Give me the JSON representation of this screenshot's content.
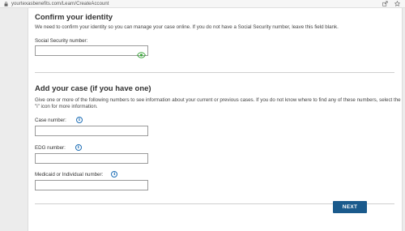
{
  "browser": {
    "url": "yourtexasbenefits.com/Learn/CreateAccount"
  },
  "identity": {
    "heading": "Confirm your identity",
    "description": "We need to confirm your identity so you can manage your case online. If you do not have a Social Security number, leave this field blank.",
    "ssn_label": "Social Security number:",
    "ssn_value": ""
  },
  "case": {
    "heading": "Add your case (if you have one)",
    "description": "Give one or more of the following numbers to see information about your current or previous cases. If you do not know where to find any of these numbers, select the \"i\" icon for more information.",
    "case_number_label": "Case number:",
    "edg_number_label": "EDG number:",
    "medicaid_label": "Medicaid or Individual number:",
    "info_glyph": "i"
  },
  "actions": {
    "next_label": "NEXT"
  },
  "colors": {
    "accent": "#1a5a8c",
    "info": "#1f6fb6",
    "eye": "#3aa53a"
  },
  "icons": [
    "lock-icon",
    "share-icon",
    "bookmark-star-icon",
    "eye-icon",
    "info-icon"
  ]
}
